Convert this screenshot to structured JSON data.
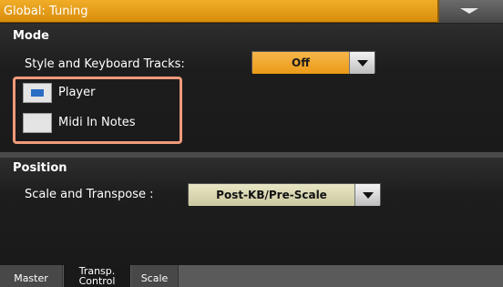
{
  "window": {
    "title": "Global: Tuning",
    "menu_icon": "chevron-down-icon"
  },
  "mode": {
    "section_title": "Mode",
    "style_keyboard_label": "Style and Keyboard Tracks:",
    "style_keyboard_value": "Off",
    "checkboxes": [
      {
        "label": "Player",
        "checked": true
      },
      {
        "label": "Midi In Notes",
        "checked": false
      }
    ]
  },
  "position": {
    "section_title": "Position",
    "scale_transpose_label": "Scale and Transpose :",
    "scale_transpose_value": "Post-KB/Pre-Scale"
  },
  "tabs": [
    {
      "label": "Master",
      "active": false
    },
    {
      "label_line1": "Transp.",
      "label_line2": "Control",
      "active": true
    },
    {
      "label": "Scale",
      "active": false
    }
  ],
  "colors": {
    "title_bar": "#e59b1a",
    "off_combo": "#eda331",
    "position_combo": "#d8d5b0",
    "highlight_box": "#ef9a7a",
    "checkbox_check": "#2b6cc5"
  }
}
